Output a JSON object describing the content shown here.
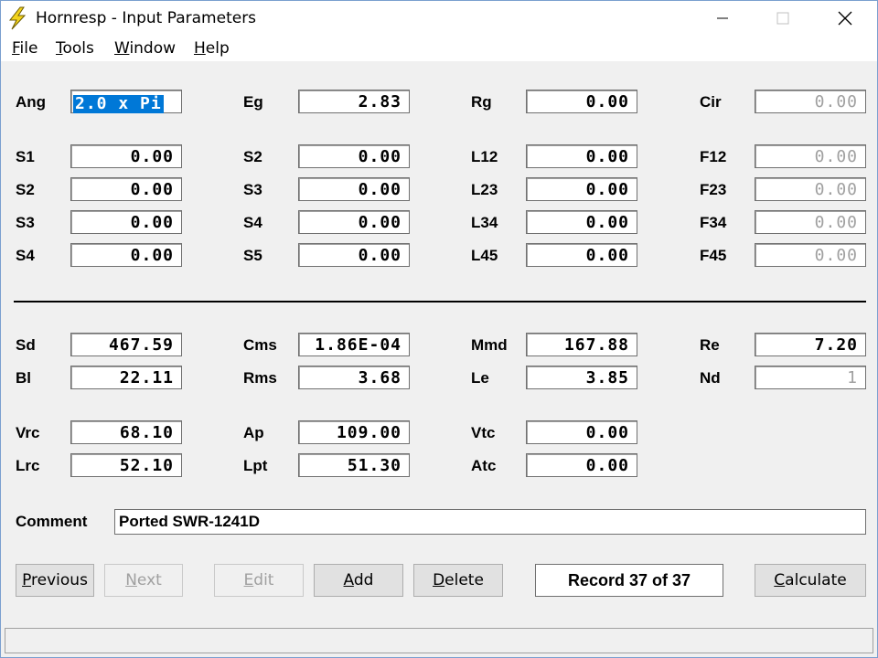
{
  "window": {
    "title": "Hornresp - Input Parameters"
  },
  "menu": {
    "file": {
      "u": "F",
      "rest": "ile"
    },
    "tools": {
      "u": "T",
      "rest": "ools"
    },
    "window": {
      "u": "W",
      "rest": "indow"
    },
    "help": {
      "u": "H",
      "rest": "elp"
    }
  },
  "row0": [
    {
      "label": "Ang",
      "value": "2.0 x Pi"
    },
    {
      "label": "Eg",
      "value": "2.83"
    },
    {
      "label": "Rg",
      "value": "0.00"
    },
    {
      "label": "Cir",
      "value": "0.00"
    }
  ],
  "grid": [
    [
      {
        "label": "S1",
        "value": "0.00"
      },
      {
        "label": "S2",
        "value": "0.00"
      },
      {
        "label": "L12",
        "value": "0.00"
      },
      {
        "label": "F12",
        "value": "0.00"
      }
    ],
    [
      {
        "label": "S2",
        "value": "0.00"
      },
      {
        "label": "S3",
        "value": "0.00"
      },
      {
        "label": "L23",
        "value": "0.00"
      },
      {
        "label": "F23",
        "value": "0.00"
      }
    ],
    [
      {
        "label": "S3",
        "value": "0.00"
      },
      {
        "label": "S4",
        "value": "0.00"
      },
      {
        "label": "L34",
        "value": "0.00"
      },
      {
        "label": "F34",
        "value": "0.00"
      }
    ],
    [
      {
        "label": "S4",
        "value": "0.00"
      },
      {
        "label": "S5",
        "value": "0.00"
      },
      {
        "label": "L45",
        "value": "0.00"
      },
      {
        "label": "F45",
        "value": "0.00"
      }
    ]
  ],
  "driver": [
    [
      {
        "label": "Sd",
        "value": "467.59"
      },
      {
        "label": "Cms",
        "value": "1.86E-04"
      },
      {
        "label": "Mmd",
        "value": "167.88"
      },
      {
        "label": "Re",
        "value": "7.20"
      }
    ],
    [
      {
        "label": "Bl",
        "value": "22.11"
      },
      {
        "label": "Rms",
        "value": "3.68"
      },
      {
        "label": "Le",
        "value": "3.85"
      },
      {
        "label": "Nd",
        "value": "1"
      }
    ]
  ],
  "chamber": [
    [
      {
        "label": "Vrc",
        "value": "68.10"
      },
      {
        "label": "Ap",
        "value": "109.00"
      },
      {
        "label": "Vtc",
        "value": "0.00"
      }
    ],
    [
      {
        "label": "Lrc",
        "value": "52.10"
      },
      {
        "label": "Lpt",
        "value": "51.30"
      },
      {
        "label": "Atc",
        "value": "0.00"
      }
    ]
  ],
  "comment": {
    "label": "Comment",
    "value": "Ported SWR-1241D"
  },
  "buttons": {
    "previous": {
      "u": "P",
      "rest": "revious"
    },
    "next": {
      "u": "N",
      "rest": "ext"
    },
    "edit": {
      "u": "E",
      "rest": "dit"
    },
    "add": {
      "u": "A",
      "rest": "dd"
    },
    "delete": {
      "u": "D",
      "rest": "elete"
    },
    "calculate": {
      "u": "C",
      "rest": "alculate"
    }
  },
  "record": "Record 37 of 37",
  "colors": {
    "selection": "#0078d7",
    "disabled_text": "#a0a0a0",
    "window_bg": "#f0f0f0"
  }
}
